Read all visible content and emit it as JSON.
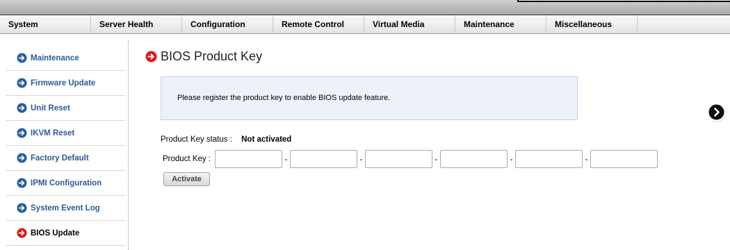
{
  "menu": {
    "items": [
      {
        "label": "System"
      },
      {
        "label": "Server Health"
      },
      {
        "label": "Configuration"
      },
      {
        "label": "Remote Control"
      },
      {
        "label": "Virtual Media"
      },
      {
        "label": "Maintenance"
      },
      {
        "label": "Miscellaneous"
      }
    ]
  },
  "sidebar": {
    "items": [
      {
        "label": "Maintenance",
        "icon": "arrow-right-circle-icon",
        "active": false
      },
      {
        "label": "Firmware Update",
        "icon": "arrow-right-circle-icon",
        "active": false
      },
      {
        "label": "Unit Reset",
        "icon": "arrow-right-circle-icon",
        "active": false
      },
      {
        "label": "IKVM Reset",
        "icon": "arrow-right-circle-icon",
        "active": false
      },
      {
        "label": "Factory Default",
        "icon": "arrow-right-circle-icon",
        "active": false
      },
      {
        "label": "IPMI Configuration",
        "icon": "arrow-right-circle-icon",
        "active": false
      },
      {
        "label": "System Event Log",
        "icon": "arrow-right-circle-icon",
        "active": false
      },
      {
        "label": "BIOS Update",
        "icon": "arrow-right-circle-icon",
        "active": true
      }
    ]
  },
  "colors": {
    "nav_arrow": "#2a5d9f",
    "active_arrow": "#e0191c",
    "nav_text": "#2d5a96",
    "info_bg": "#edf2f9"
  },
  "main": {
    "title": "BIOS Product Key",
    "title_icon": "arrow-right-circle-red-icon",
    "info_message": "Please register the product key to enable BIOS update feature.",
    "status_label": "Product Key status :",
    "status_value": "Not activated",
    "key_label": "Product Key :",
    "key_fields": [
      "",
      "",
      "",
      "",
      "",
      ""
    ],
    "key_separator": "-",
    "activate_label": "Activate",
    "next_icon": "chevron-right-circle-icon"
  }
}
